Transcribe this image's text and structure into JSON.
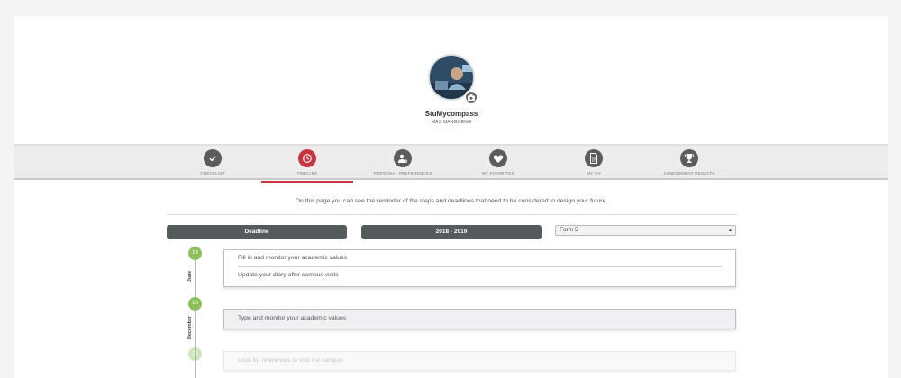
{
  "profile": {
    "name": "StuMycompass",
    "school": "MAS MANGOENG",
    "avatar_icon": "profile-photo",
    "camera_icon": "camera-icon"
  },
  "tabs": [
    {
      "label": "CHECKLIST",
      "icon": "check-icon",
      "active": false
    },
    {
      "label": "TIMELINE",
      "icon": "clock-icon",
      "active": true
    },
    {
      "label": "PERSONAL PREFERENCES",
      "icon": "user-settings-icon",
      "active": false
    },
    {
      "label": "MY FAVORITES",
      "icon": "heart-icon",
      "active": false
    },
    {
      "label": "MY CV",
      "icon": "document-icon",
      "active": false
    },
    {
      "label": "ASSESSMENT RESULTS",
      "icon": "trophy-icon",
      "active": false
    }
  ],
  "colors": {
    "accent": "#c8353f",
    "tab_icon": "#5c5c5c",
    "timeline_dot": "#8cc05a",
    "pill": "#555a5d"
  },
  "intro": "On this page you can see the reminder of the steps and deadlines that need to be considered to design your future.",
  "controls": {
    "deadline_label": "Deadline",
    "year_label": "2018 - 2019",
    "form_selected": "Form 5"
  },
  "timeline": {
    "groups": [
      {
        "day": "19",
        "month": "June",
        "items": [
          "Fill in and monitor your academic values",
          "Update your diary after campus visits"
        ]
      },
      {
        "day": "18",
        "month": "December",
        "items": [
          "Type and monitor your academic values"
        ]
      },
      {
        "day": "18",
        "month": "",
        "items": [
          "Look for references to visit the campus"
        ]
      }
    ]
  }
}
